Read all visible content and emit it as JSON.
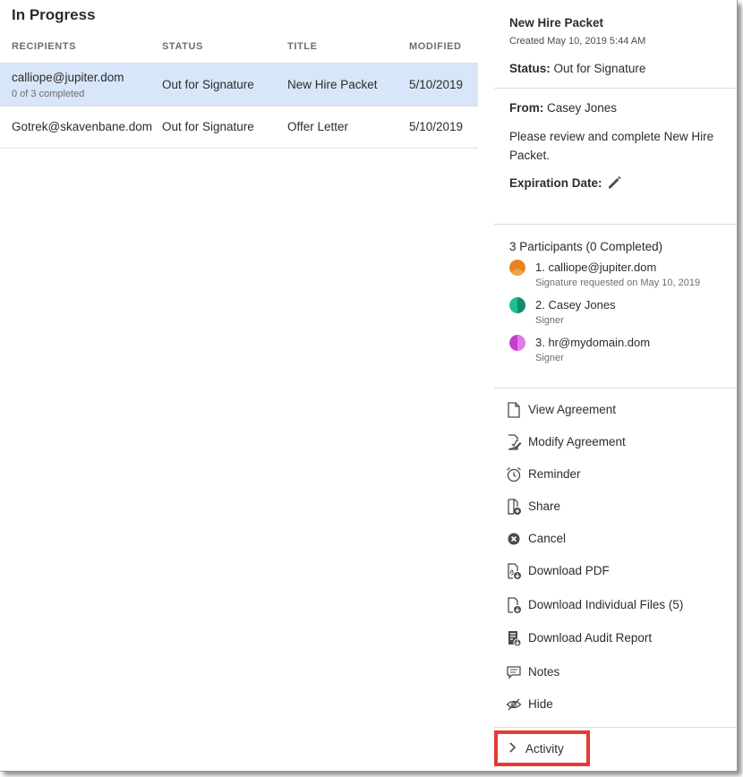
{
  "list": {
    "title": "In Progress",
    "columns": [
      "RECIPIENTS",
      "STATUS",
      "TITLE",
      "MODIFIED"
    ],
    "rows": [
      {
        "recipient": "calliope@jupiter.dom",
        "progress": "0 of 3 completed",
        "status": "Out for Signature",
        "title": "New Hire Packet",
        "modified": "5/10/2019",
        "selected": true
      },
      {
        "recipient": "Gotrek@skavenbane.dom",
        "progress": "",
        "status": "Out for Signature",
        "title": "Offer Letter",
        "modified": "5/10/2019",
        "selected": false
      }
    ]
  },
  "panel": {
    "title": "New Hire Packet",
    "created": "Created May 10, 2019 5:44 AM",
    "status_label": "Status:",
    "status_value": "Out for Signature",
    "from_label": "From:",
    "from_value": "Casey Jones",
    "message": "Please review and complete New Hire Packet.",
    "expiration_label": "Expiration Date:",
    "participants_heading": "3 Participants (0 Completed)",
    "participants": [
      {
        "name": "1. calliope@jupiter.dom",
        "role": "Signature requested on May 10, 2019",
        "color": "#e8831c"
      },
      {
        "name": "2. Casey Jones",
        "role": "Signer",
        "color": "#1fbf8f"
      },
      {
        "name": "3. hr@mydomain.dom",
        "role": "Signer",
        "color": "#c23fd1"
      }
    ],
    "actions": [
      {
        "label": "View Agreement",
        "icon": "document-icon"
      },
      {
        "label": "Modify Agreement",
        "icon": "edit-document-icon"
      },
      {
        "label": "Reminder",
        "icon": "alarm-clock-icon"
      },
      {
        "label": "Share",
        "icon": "share-document-icon"
      },
      {
        "label": "Cancel",
        "icon": "cancel-circle-icon"
      },
      {
        "label": "Download PDF",
        "icon": "download-pdf-icon"
      },
      {
        "label": "Download Individual Files (5)",
        "icon": "download-files-icon"
      },
      {
        "label": "Download Audit Report",
        "icon": "audit-report-icon"
      },
      {
        "label": "Notes",
        "icon": "notes-icon"
      },
      {
        "label": "Hide",
        "icon": "hide-eye-icon"
      }
    ],
    "activity_label": "Activity"
  },
  "colors": {
    "selected_row": "#d7e6f8",
    "highlight_border": "#e53935"
  }
}
